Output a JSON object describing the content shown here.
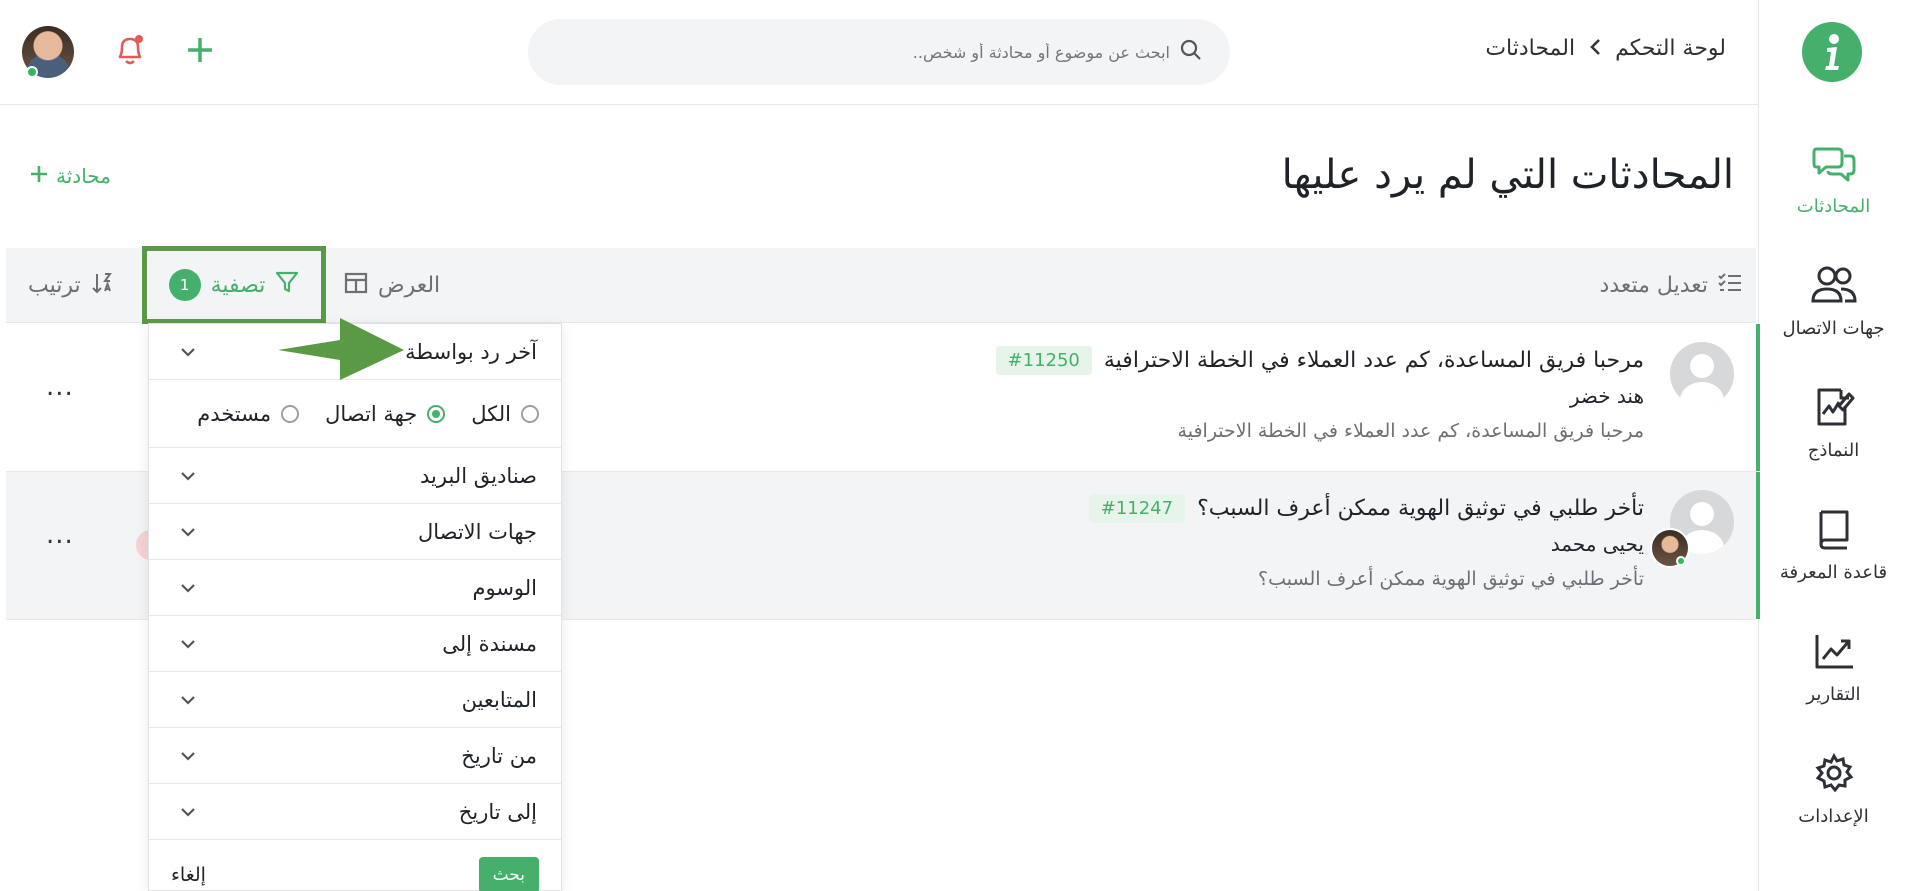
{
  "colors": {
    "accent": "#45b06c",
    "highlight": "#5b9a45",
    "arrow": "#5b9a45"
  },
  "sidebar": {
    "items": [
      {
        "label": "المحادثات",
        "icon": "chat-icon",
        "active": true
      },
      {
        "label": "جهات الاتصال",
        "icon": "contacts-icon",
        "active": false
      },
      {
        "label": "النماذج",
        "icon": "forms-icon",
        "active": false
      },
      {
        "label": "قاعدة المعرفة",
        "icon": "book-icon",
        "active": false
      },
      {
        "label": "التقارير",
        "icon": "reports-icon",
        "active": false
      },
      {
        "label": "الإعدادات",
        "icon": "gear-icon",
        "active": false
      }
    ]
  },
  "header": {
    "breadcrumb": [
      "لوحة التحكم",
      "المحادثات"
    ],
    "search_placeholder": "ابحث عن موضوع أو محادثة أو شخص.."
  },
  "page": {
    "title": "المحادثات التي لم يرد عليها",
    "new_conversation": "محادثة"
  },
  "toolbar": {
    "multi_edit": "تعديل متعدد",
    "view": "العرض",
    "filter": "تصفية",
    "filter_count": "1",
    "sort": "ترتيب"
  },
  "conversations": [
    {
      "id": "#11250",
      "subject": "مرحبا فريق المساعدة، كم عدد العملاء في الخطة الاحترافية",
      "name": "هند خضر",
      "preview": "مرحبا فريق المساعدة، كم عدد العملاء في الخطة الاحترافية",
      "more": "..."
    },
    {
      "id": "#11247",
      "subject": "تأخر طلبي في توثيق الهوية ممكن أعرف السبب؟",
      "name": "يحيى محمد",
      "preview": "تأخر طلبي في توثيق الهوية ممكن أعرف السبب؟",
      "more": "..."
    }
  ],
  "filter_panel": {
    "last_reply_by": "آخر رد بواسطة",
    "options": [
      {
        "label": "الكل",
        "checked": false
      },
      {
        "label": "جهة اتصال",
        "checked": true
      },
      {
        "label": "مستخدم",
        "checked": false
      }
    ],
    "sections": [
      "صناديق البريد",
      "جهات الاتصال",
      "الوسوم",
      "مسندة إلى",
      "المتابعين",
      "من تاريخ",
      "إلى تاريخ"
    ],
    "search_button": "بحث",
    "cancel_button": "إلغاء"
  }
}
